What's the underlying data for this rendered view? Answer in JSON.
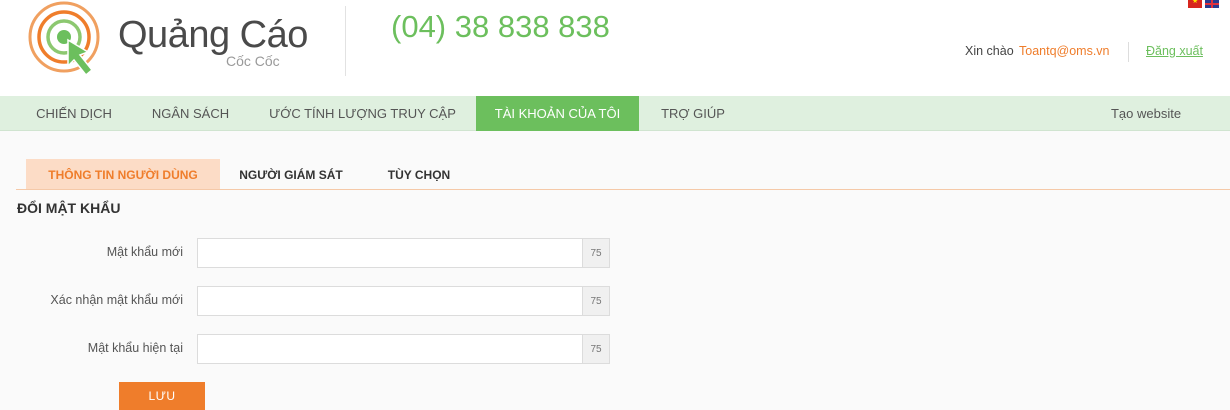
{
  "header": {
    "logo_title": "Quảng Cáo",
    "logo_subtitle": "Cốc Cốc",
    "phone": "(04) 38 838 838",
    "greeting": "Xin chào",
    "user_email": "Toantq@oms.vn",
    "logout_label": "Đăng xuất",
    "brand_color": "#6cbf5d",
    "accent_color": "#ef7d2b"
  },
  "nav": {
    "items": [
      {
        "label": "CHIẾN DỊCH",
        "active": false
      },
      {
        "label": "NGÂN SÁCH",
        "active": false
      },
      {
        "label": "ƯỚC TÍNH LƯỢNG TRUY CẬP",
        "active": false
      },
      {
        "label": "TÀI KHOẢN CỦA TÔI",
        "active": true
      },
      {
        "label": "TRỢ GIÚP",
        "active": false
      }
    ],
    "right_link": "Tạo website"
  },
  "subtabs": [
    {
      "label": "THÔNG TIN NGƯỜI DÙNG",
      "active": true
    },
    {
      "label": "NGƯỜI GIÁM SÁT",
      "active": false
    },
    {
      "label": "TÙY CHỌN",
      "active": false
    }
  ],
  "form": {
    "title": "ĐỔI MẬT KHẨU",
    "fields": [
      {
        "label": "Mật khẩu mới",
        "value": "",
        "counter": "75"
      },
      {
        "label": "Xác nhận mật khẩu mới",
        "value": "",
        "counter": "75"
      },
      {
        "label": "Mật khẩu hiện tại",
        "value": "",
        "counter": "75"
      }
    ],
    "save_label": "LƯU"
  }
}
